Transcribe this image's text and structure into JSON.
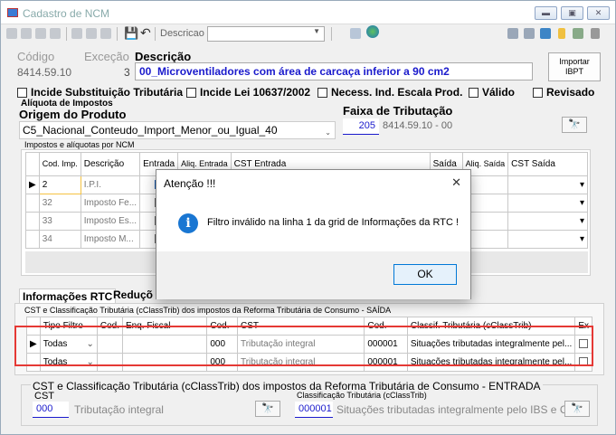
{
  "window": {
    "title": "Cadastro de NCM",
    "min": "▭",
    "max": "▭",
    "close": "✕"
  },
  "toolbar": {
    "descricao_combo": "Descricao"
  },
  "header": {
    "codigo_label": "Código",
    "excecao_label": "Exceção",
    "descricao_label": "Descrição",
    "codigo_value": "8414.59.10",
    "excecao_value": "3",
    "descricao_value": "00_Microventiladores com área de carcaça inferior a 90 cm2",
    "importar_btn_line1": "Importar",
    "importar_btn_line2": "IBPT"
  },
  "checkboxes": [
    {
      "label": "Incide Substituição Tributária"
    },
    {
      "label": "Incide Lei 10637/2002"
    },
    {
      "label": "Necess. Ind. Escala Prod."
    },
    {
      "label": "Válido"
    },
    {
      "label": "Revisado"
    }
  ],
  "aliquota": {
    "title": "Alíquota de Impostos",
    "origem_label": "Origem do Produto",
    "origem_value": "C5_Nacional_Conteudo_Import_Menor_ou_Igual_40",
    "faixa_label": "Faixa de Tributação",
    "faixa_code": "205",
    "faixa_desc": "8414.59.10 - 00"
  },
  "impostos_grid": {
    "title": "Impostos e alíquotas por NCM",
    "headers": [
      "Cod. Imp.",
      "Descrição",
      "Entrada",
      "Aliq. Entrada",
      "CST Entrada",
      "Saída",
      "Aliq. Saída",
      "CST Saída"
    ],
    "rows": [
      {
        "cod": "2",
        "desc": "I.P.I.",
        "entrada": true
      },
      {
        "cod": "32",
        "desc": "Imposto Fe...",
        "entrada": false
      },
      {
        "cod": "33",
        "desc": "Imposto Es...",
        "entrada": false
      },
      {
        "cod": "34",
        "desc": "Imposto M...",
        "entrada": false
      }
    ]
  },
  "tabs": {
    "info_rtc": "Informações RTC",
    "reducao": "Reduçõ"
  },
  "rtc_saida": {
    "title": "CST e Classificação Tributária (cClassTrib) dos impostos da Reforma Tributária de Consumo - SAÍDA",
    "headers": [
      "Tipo Filtro",
      "Cod.",
      "Enq. Fiscal",
      "Cod.",
      "CST",
      "Cod.",
      "Classif. Tributária (cClassTrib)",
      "Ex"
    ],
    "rows": [
      {
        "tipo": "Todas",
        "cod_cst": "000",
        "cst": "Tributação integral",
        "cod_class": "000001",
        "classif": "Situações tributadas integralmente pel..."
      },
      {
        "tipo": "Todas",
        "cod_cst": "000",
        "cst": "Tributação integral",
        "cod_class": "000001",
        "classif": "Situações tributadas integralmente pel..."
      }
    ]
  },
  "rtc_entrada": {
    "title": "CST e Classificação Tributária (cClassTrib) dos impostos da Reforma Tributária de Consumo - ENTRADA",
    "cst_label": "CST",
    "cst_code": "000",
    "cst_desc": "Tributação integral",
    "class_label": "Classificação Tributária (cClassTrib)",
    "class_code": "000001",
    "class_desc": "Situações tributadas integralmente pelo IBS e CBS."
  },
  "dialog": {
    "title": "Atenção !!!",
    "message": "Filtro inválido na linha 1 da grid de Informações da RTC !",
    "ok": "OK",
    "close": "✕"
  },
  "colors": {
    "accent": "#0078d7",
    "highlight_box": "#e53935",
    "blue_text": "#1a1acc"
  }
}
